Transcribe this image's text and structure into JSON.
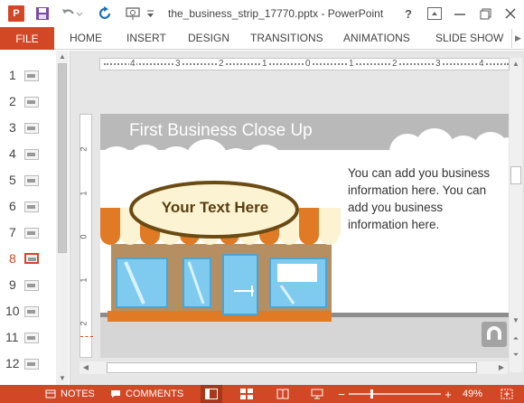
{
  "titlebar": {
    "app_icon_letter": "P",
    "document_title": "the_business_strip_17770.pptx - PowerPoint",
    "help_label": "?"
  },
  "ribbon": {
    "file": "FILE",
    "tabs": [
      "HOME",
      "INSERT",
      "DESIGN",
      "TRANSITIONS",
      "ANIMATIONS",
      "SLIDE SHOW"
    ]
  },
  "thumbnails": {
    "slides": [
      "1",
      "2",
      "3",
      "4",
      "5",
      "6",
      "7",
      "8",
      "9",
      "10",
      "11",
      "12"
    ],
    "active_slide": "8"
  },
  "ruler": {
    "h_numbers": [
      "4",
      "3",
      "2",
      "1",
      "0",
      "1",
      "2",
      "3",
      "4"
    ],
    "v_numbers": [
      "2",
      "1",
      "0",
      "1",
      "2"
    ]
  },
  "slide": {
    "title": "First Business Close Up",
    "sign_text": "Your Text Here",
    "body": "You can add you business information here. You can add you business information here."
  },
  "statusbar": {
    "notes": "NOTES",
    "comments": "COMMENTS",
    "zoom_out": "−",
    "zoom_in": "+",
    "zoom_level": "49%"
  },
  "colors": {
    "accent": "#d24726",
    "awning_orange": "#e07a24",
    "sign_fill": "#fbf3d2",
    "sign_border": "#6b4b14",
    "store_wall": "#b58f62",
    "window_blue": "#7ecbef",
    "header_gray": "#b9b9b9"
  },
  "icons": {
    "save": "save-icon",
    "undo": "undo-icon",
    "redo": "redo-icon",
    "present": "present-icon",
    "ribbon_display": "ribbon-display-icon",
    "minimize": "minimize-icon",
    "maximize": "maximize-icon",
    "close": "close-icon"
  }
}
